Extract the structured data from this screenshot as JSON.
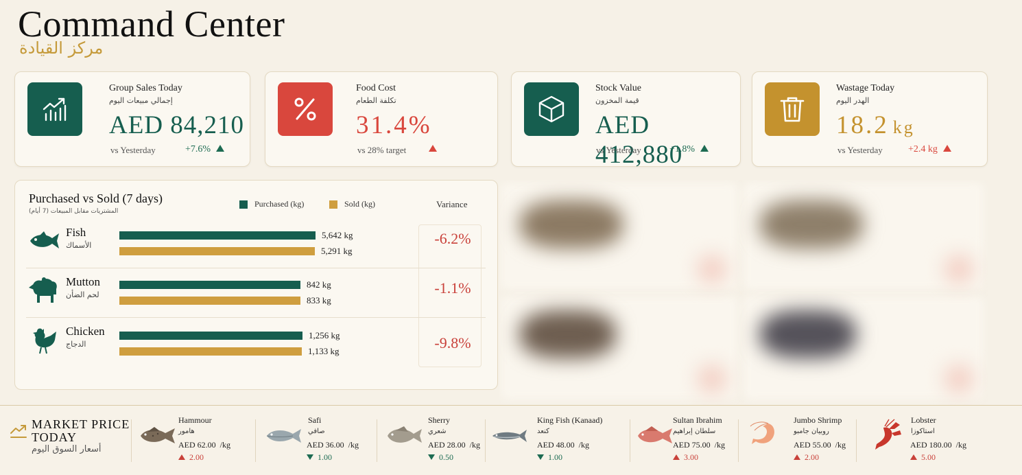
{
  "header": {
    "title": "Command Center",
    "title_ar": "مركز القيادة"
  },
  "colors": {
    "green": "#165e4f",
    "red": "#d9473d",
    "gold": "#cf9e3f",
    "background": "#f6f1e7"
  },
  "kpis": [
    {
      "label": "Group Sales Today",
      "label_ar": "إجمالي مبيعات اليوم",
      "value": "AED 84,210",
      "compare": "vs Yesterday",
      "delta": "+7.6%",
      "trend": "up",
      "icon": "trend-chart-icon",
      "tile_color": "#165e4f"
    },
    {
      "label": "Food Cost",
      "label_ar": "تكلفة الطعام",
      "value": "31.4%",
      "compare": "vs 28% target",
      "delta": "",
      "trend": "up",
      "icon": "percent-icon",
      "tile_color": "#d9473d"
    },
    {
      "label": "Stock Value",
      "label_ar": "قيمة المخزون",
      "value": "AED 412,880",
      "compare": "vs Yesterday",
      "delta": "+1.8%",
      "trend": "up",
      "icon": "box-icon",
      "tile_color": "#165e4f"
    },
    {
      "label": "Wastage Today",
      "label_ar": "الهدر اليوم",
      "value": "18.2",
      "unit": "kg",
      "compare": "vs Yesterday",
      "delta": "+2.4 kg",
      "trend": "up",
      "icon": "trash-icon",
      "tile_color": "#c4922e"
    }
  ],
  "purchased_vs_sold": {
    "title": "Purchased vs Sold  (7 days)",
    "title_ar": "المشتريات مقابل المبيعات (7 أيام)",
    "legend_purchased": "Purchased (kg)",
    "legend_sold": "Sold (kg)",
    "variance_header": "Variance",
    "rows": [
      {
        "name": "Fish",
        "name_ar": "الأسماك",
        "icon": "fish-icon",
        "purchased": 5642,
        "purchased_label": "5,642 kg",
        "sold": 5291,
        "sold_label": "5,291 kg",
        "variance": "-6.2%"
      },
      {
        "name": "Mutton",
        "name_ar": "لحم الضأن",
        "icon": "sheep-icon",
        "purchased": 842,
        "purchased_label": "842 kg",
        "sold": 833,
        "sold_label": "833 kg",
        "variance": "-1.1%"
      },
      {
        "name": "Chicken",
        "name_ar": "الدجاج",
        "icon": "chicken-icon",
        "purchased": 1256,
        "purchased_label": "1,256 kg",
        "sold": 1133,
        "sold_label": "1,133 kg",
        "variance": "-9.8%"
      }
    ]
  },
  "market": {
    "title": "MARKET  PRICE TODAY",
    "title_ar": "أسعار السوق اليوم",
    "icon": "trend-line-icon",
    "items": [
      {
        "name": "Hammour",
        "name_ar": "هامور",
        "price": "AED 62.00",
        "unit": "/kg",
        "change": "2.00",
        "trend": "up",
        "icon": "hammour-fish-icon"
      },
      {
        "name": "Safi",
        "name_ar": "صافي",
        "price": "AED 36.00",
        "unit": "/kg",
        "change": "1.00",
        "trend": "down",
        "icon": "safi-fish-icon"
      },
      {
        "name": "Sherry",
        "name_ar": "شعري",
        "price": "AED 28.00",
        "unit": "/kg",
        "change": "0.50",
        "trend": "down",
        "icon": "sherry-fish-icon"
      },
      {
        "name": "King Fish (Kanaad)",
        "name_ar": "كنعد",
        "price": "AED 48.00",
        "unit": "/kg",
        "change": "1.00",
        "trend": "down",
        "icon": "kingfish-icon"
      },
      {
        "name": "Sultan Ibrahim",
        "name_ar": "سلطان إبراهيم",
        "price": "AED 75.00",
        "unit": "/kg",
        "change": "3.00",
        "trend": "up",
        "icon": "sultan-ibrahim-fish-icon"
      },
      {
        "name": "Jumbo Shrimp",
        "name_ar": "روبيان جامبو",
        "price": "AED 55.00",
        "unit": "/kg",
        "change": "2.00",
        "trend": "up",
        "icon": "shrimp-icon"
      },
      {
        "name": "Lobster",
        "name_ar": "استاكوزا",
        "price": "AED 180.00",
        "unit": "/kg",
        "change": "5.00",
        "trend": "up",
        "icon": "lobster-icon"
      }
    ]
  }
}
